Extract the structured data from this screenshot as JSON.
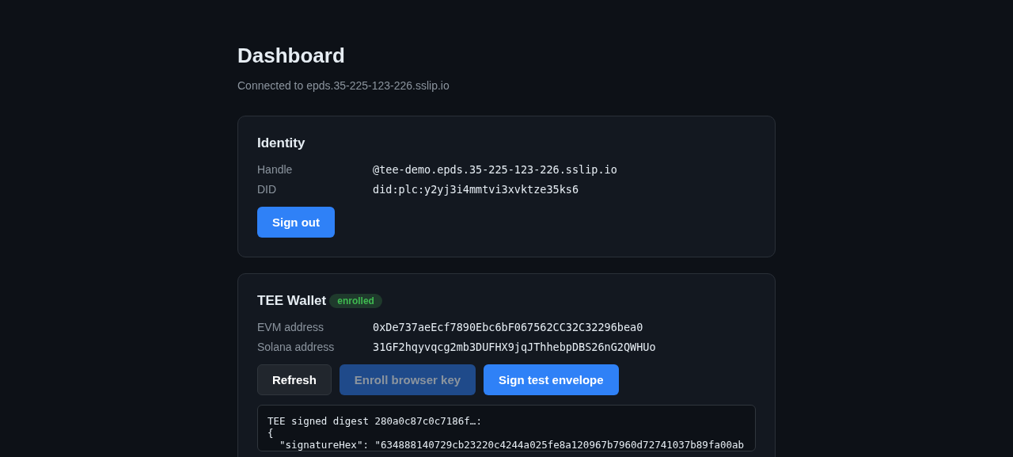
{
  "title": "Dashboard",
  "subtitle": "Connected to epds.35-225-123-226.sslip.io",
  "identity": {
    "title": "Identity",
    "fields": [
      {
        "label": "Handle",
        "value": "@tee-demo.epds.35-225-123-226.sslip.io"
      },
      {
        "label": "DID",
        "value": "did:plc:y2yj3i4mmtvi3xvktze35ks6"
      }
    ],
    "buttons": [
      {
        "label": "Sign out",
        "kind": "primary",
        "disabled": false
      }
    ]
  },
  "wallet": {
    "title": "TEE Wallet",
    "badge": "enrolled",
    "fields": [
      {
        "label": "EVM address",
        "value": "0xDe737aeEcf7890Ebc6bF067562CC32C32296bea0"
      },
      {
        "label": "Solana address",
        "value": "31GF2hqyvqcg2mb3DUFHX9jqJThhebpDBS26nG2QWHUo"
      }
    ],
    "buttons": [
      {
        "label": "Refresh",
        "kind": "secondary",
        "disabled": false
      },
      {
        "label": "Enroll browser key",
        "kind": "primary",
        "disabled": true
      },
      {
        "label": "Sign test envelope",
        "kind": "primary",
        "disabled": false
      }
    ],
    "output": [
      "TEE signed digest 280a0c87c0c7186f…:",
      "{",
      "  \"signatureHex\": \"634888140729cb23220c4244a025fe8a120967b7960d72741037b89fa00ab"
    ]
  }
}
